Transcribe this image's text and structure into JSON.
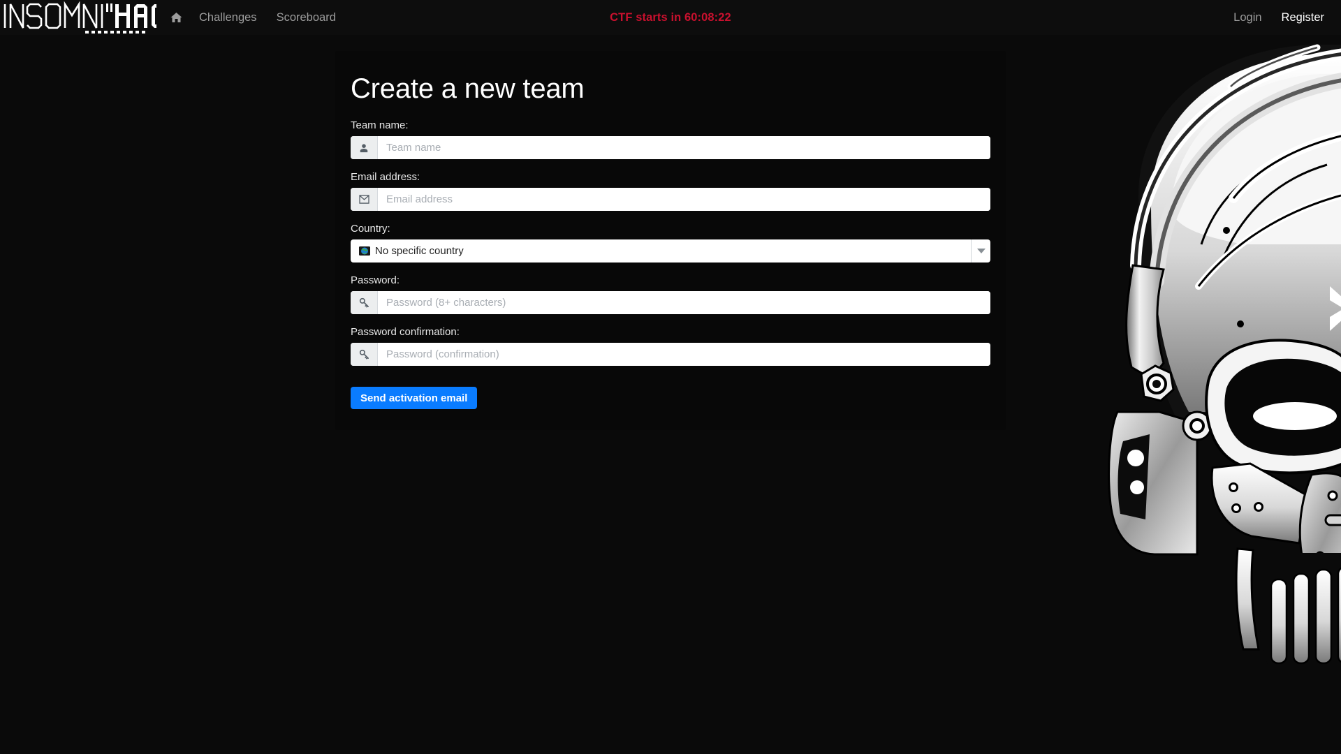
{
  "navbar": {
    "brand_text": "INSOMNI'HACK",
    "home_icon": "home-icon",
    "links": [
      {
        "label": "Challenges",
        "active": false
      },
      {
        "label": "Scoreboard",
        "active": false
      }
    ],
    "countdown": "CTF starts in 60:08:22",
    "countdown_color": "#c9102e",
    "auth": [
      {
        "label": "Login",
        "active": false
      },
      {
        "label": "Register",
        "active": true
      }
    ]
  },
  "page": {
    "title": "Create a new team"
  },
  "form": {
    "fields": [
      {
        "label": "Team name:",
        "placeholder": "Team name",
        "value": "",
        "icon": "user-icon",
        "type": "text"
      },
      {
        "label": "Email address:",
        "placeholder": "Email address",
        "value": "",
        "icon": "envelope-icon",
        "type": "email"
      },
      {
        "label": "Password:",
        "placeholder": "Password (8+ characters)",
        "value": "",
        "icon": "key-icon",
        "type": "password"
      },
      {
        "label": "Password confirmation:",
        "placeholder": "Password (confirmation)",
        "value": "",
        "icon": "key-icon",
        "type": "password"
      }
    ],
    "country": {
      "label": "Country:",
      "selected": "No specific country",
      "icon": "globe-icon"
    },
    "submit_label": "Send activation email",
    "submit_color": "#0a7cff"
  },
  "artwork": {
    "name": "cyborg-skull-illustration"
  }
}
